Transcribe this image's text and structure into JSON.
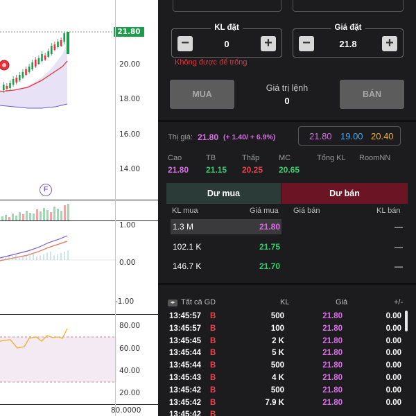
{
  "chart": {
    "current_price": "21.80",
    "price_axis": [
      "20.00",
      "18.00",
      "16.00",
      "14.00"
    ],
    "f_marker": "F",
    "macd_axis": [
      "1.00",
      "0.00",
      "-1.00"
    ],
    "rsi_axis": [
      "80.00",
      "60.00",
      "40.00",
      "20.00"
    ],
    "bottom_axis": "80.0000",
    "colors": {
      "up": "#1b9e4a",
      "down": "#e8323c",
      "ma": "#e8323c",
      "band": "#7b5cc9"
    }
  },
  "order": {
    "qty_title": "KL đặt",
    "qty_value": "0",
    "price_title": "Giá đặt",
    "price_value": "21.8",
    "warning": "Không được để trống",
    "buy_label": "MUA",
    "sell_label": "BÁN",
    "order_value_label": "Giá trị lệnh",
    "order_value": "0"
  },
  "market": {
    "price_label": "Thị giá:",
    "price": "21.80",
    "change": "(+ 1.40/ + 6.9%)",
    "box": {
      "ceiling": "21.80",
      "reference": "19.00",
      "floor": "20.40"
    },
    "stats": [
      {
        "label": "Cao",
        "value": "21.80",
        "color": "pink"
      },
      {
        "label": "TB",
        "value": "21.15",
        "color": "green"
      },
      {
        "label": "Thấp",
        "value": "20.25",
        "color": "red"
      },
      {
        "label": "MC",
        "value": "20.65",
        "color": "green"
      },
      {
        "label": "Tổng KL",
        "value": ""
      },
      {
        "label": "RoomNN",
        "value": ""
      }
    ]
  },
  "book": {
    "tab_buy": "Dư mua",
    "tab_sell": "Dư bán",
    "headers": {
      "buy_vol": "KL mua",
      "buy_price": "Giá mua",
      "sell_price": "Giá bán",
      "sell_vol": "KL bán"
    },
    "rows": [
      {
        "vol": "1.3 M",
        "price": "21.80",
        "color": "pink",
        "sell": "—"
      },
      {
        "vol": "102.1 K",
        "price": "21.75",
        "color": "green",
        "sell": "—"
      },
      {
        "vol": "146.7 K",
        "price": "21.70",
        "color": "green",
        "sell": "—"
      }
    ]
  },
  "trades": {
    "headers": {
      "all": "Tất cả GD",
      "kl": "KL",
      "price": "Giá",
      "chg": "+/-"
    },
    "rows": [
      {
        "time": "13:45:57",
        "side": "B",
        "kl": "500",
        "price": "21.80",
        "chg": "0.00"
      },
      {
        "time": "13:45:57",
        "side": "B",
        "kl": "100",
        "price": "21.80",
        "chg": "0.00"
      },
      {
        "time": "13:45:45",
        "side": "B",
        "kl": "2 K",
        "price": "21.80",
        "chg": "0.00"
      },
      {
        "time": "13:45:44",
        "side": "B",
        "kl": "5 K",
        "price": "21.80",
        "chg": "0.00"
      },
      {
        "time": "13:45:44",
        "side": "B",
        "kl": "500",
        "price": "21.80",
        "chg": "0.00"
      },
      {
        "time": "13:45:43",
        "side": "B",
        "kl": "4 K",
        "price": "21.80",
        "chg": "0.00"
      },
      {
        "time": "13:45:42",
        "side": "B",
        "kl": "500",
        "price": "21.80",
        "chg": "0.00"
      },
      {
        "time": "13:45:42",
        "side": "B",
        "kl": "7.9 K",
        "price": "21.80",
        "chg": "0.00"
      },
      {
        "time": "13:45:42",
        "side": "B",
        "kl": "",
        "price": "",
        "chg": ""
      }
    ]
  }
}
